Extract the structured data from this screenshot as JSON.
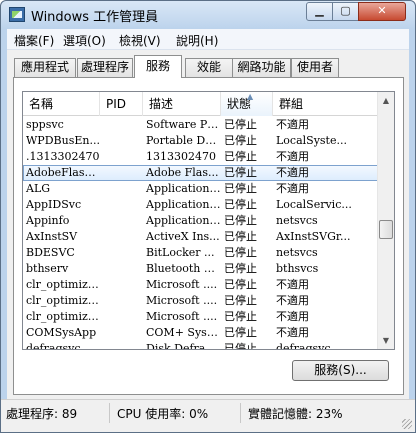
{
  "window": {
    "title": "Windows 工作管理員"
  },
  "menu": [
    "檔案(F)",
    "選項(O)",
    "檢視(V)",
    "說明(H)"
  ],
  "tabs": [
    "應用程式",
    "處理程序",
    "服務",
    "效能",
    "網路功能",
    "使用者"
  ],
  "active_tab": "服務",
  "columns": [
    "名稱",
    "PID",
    "描述",
    "狀態",
    "群組"
  ],
  "sorted_column": "狀態",
  "rows": [
    {
      "name": "sppsvc",
      "pid": "",
      "desc": "Software Pr...",
      "status": "已停止",
      "group": "不適用"
    },
    {
      "name": "WPDBusEn...",
      "pid": "",
      "desc": "Portable De...",
      "status": "已停止",
      "group": "LocalSyste..."
    },
    {
      "name": ".1313302470",
      "pid": "",
      "desc": "1313302470",
      "status": "已停止",
      "group": "不適用"
    },
    {
      "name": "AdobeFlash...",
      "pid": "",
      "desc": "Adobe Flas...",
      "status": "已停止",
      "group": "不適用",
      "selected": true
    },
    {
      "name": "ALG",
      "pid": "",
      "desc": "Application ...",
      "status": "已停止",
      "group": "不適用"
    },
    {
      "name": "AppIDSvc",
      "pid": "",
      "desc": "Application ...",
      "status": "已停止",
      "group": "LocalServic..."
    },
    {
      "name": "Appinfo",
      "pid": "",
      "desc": "Application ...",
      "status": "已停止",
      "group": "netsvcs"
    },
    {
      "name": "AxInstSV",
      "pid": "",
      "desc": "ActiveX Ins...",
      "status": "已停止",
      "group": "AxInstSVGr..."
    },
    {
      "name": "BDESVC",
      "pid": "",
      "desc": "BitLocker ...",
      "status": "已停止",
      "group": "netsvcs"
    },
    {
      "name": "bthserv",
      "pid": "",
      "desc": "Bluetooth S...",
      "status": "已停止",
      "group": "bthsvcs"
    },
    {
      "name": "clr_optimiza...",
      "pid": "",
      "desc": "Microsoft ....",
      "status": "已停止",
      "group": "不適用"
    },
    {
      "name": "clr_optimiza...",
      "pid": "",
      "desc": "Microsoft ....",
      "status": "已停止",
      "group": "不適用"
    },
    {
      "name": "clr_optimiza...",
      "pid": "",
      "desc": "Microsoft ....",
      "status": "已停止",
      "group": "不適用"
    },
    {
      "name": "COMSysApp",
      "pid": "",
      "desc": "COM+ Syst...",
      "status": "已停止",
      "group": "不適用"
    },
    {
      "name": "defragsvc",
      "pid": "",
      "desc": "Disk Defrag...",
      "status": "已停止",
      "group": "defragsvc"
    }
  ],
  "buttons": {
    "services": "服務(S)..."
  },
  "status": {
    "processes": "處理程序: 89",
    "cpu": "CPU 使用率: 0%",
    "memory": "實體記憶體: 23%"
  }
}
